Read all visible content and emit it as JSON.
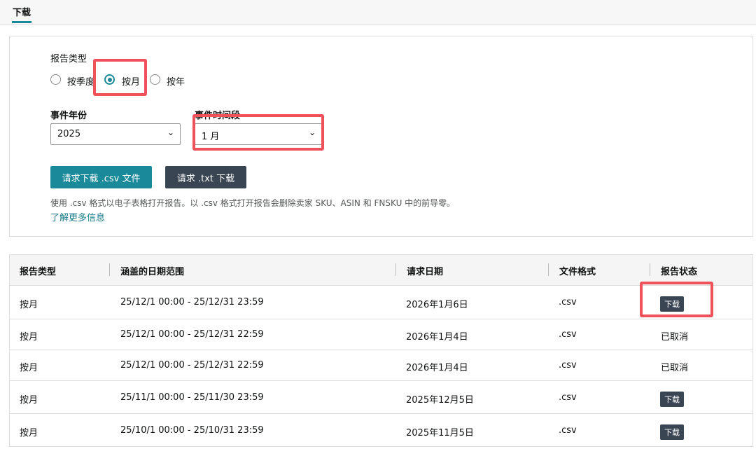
{
  "tab": "下载",
  "form": {
    "report_type_label": "报告类型",
    "radios": [
      {
        "label": "按季度",
        "checked": false
      },
      {
        "label": "按月",
        "checked": true
      },
      {
        "label": "按年",
        "checked": false
      }
    ],
    "year_label": "事件年份",
    "year_value": "2025",
    "period_label": "事件时间段",
    "period_value": "1 月",
    "csv_button": "请求下载 .csv 文件",
    "txt_button": "请求 .txt 下载",
    "hint": "使用 .csv 格式以电子表格打开报告。以 .csv 格式打开报告会删除卖家 SKU、ASIN 和 FNSKU 中的前导零。",
    "learn_more": "了解更多信息"
  },
  "table": {
    "headers": [
      "报告类型",
      "涵盖的日期范围",
      "请求日期",
      "文件格式",
      "报告状态"
    ],
    "rows": [
      {
        "type": "按月",
        "range": "25/12/1 00:00 - 25/12/31 23:59",
        "date": "2026年1月6日",
        "format": ".csv",
        "status": "下载",
        "downloadable": true
      },
      {
        "type": "按月",
        "range": "25/12/1 00:00 - 25/12/31 22:59",
        "date": "2026年1月4日",
        "format": ".csv",
        "status": "已取消",
        "downloadable": false
      },
      {
        "type": "按月",
        "range": "25/12/1 00:00 - 25/12/31 22:59",
        "date": "2026年1月4日",
        "format": ".csv",
        "status": "已取消",
        "downloadable": false
      },
      {
        "type": "按月",
        "range": "25/11/1 00:00 - 25/11/30 23:59",
        "date": "2025年12月5日",
        "format": ".csv",
        "status": "下载",
        "downloadable": true
      },
      {
        "type": "按月",
        "range": "25/10/1 00:00 - 25/10/31 23:59",
        "date": "2025年11月5日",
        "format": ".csv",
        "status": "下载",
        "downloadable": true
      }
    ]
  },
  "colors": {
    "accent": "#1a8a9a",
    "dark_button": "#3a4553",
    "highlight": "#f0515a"
  }
}
